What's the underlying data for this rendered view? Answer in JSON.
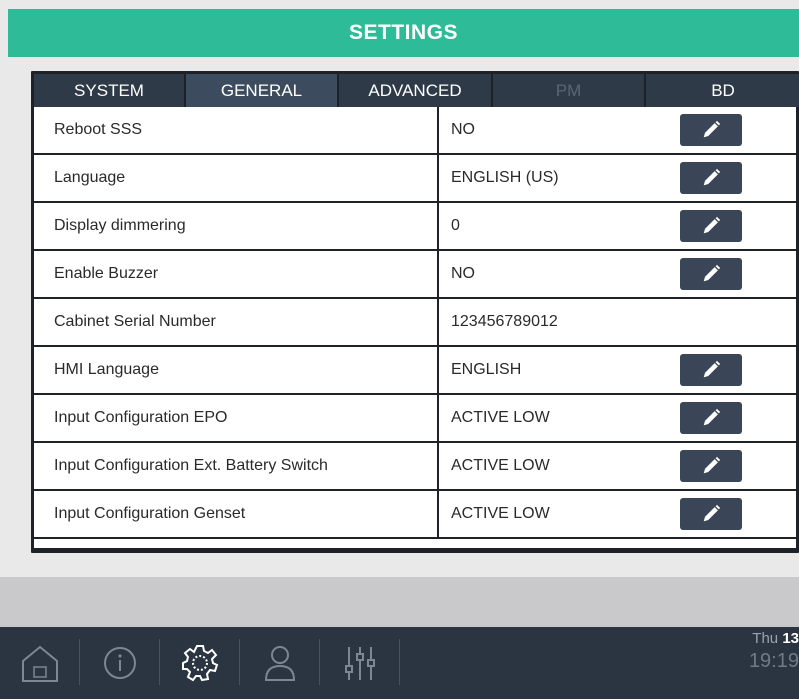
{
  "header": {
    "title": "SETTINGS"
  },
  "tabs": [
    {
      "label": "SYSTEM"
    },
    {
      "label": "GENERAL"
    },
    {
      "label": "ADVANCED"
    },
    {
      "label": "PM"
    },
    {
      "label": "BD"
    }
  ],
  "active_tab": "GENERAL",
  "rows": [
    {
      "label": "Reboot SSS",
      "value": "NO",
      "editable": true
    },
    {
      "label": "Language",
      "value": "ENGLISH (US)",
      "editable": true
    },
    {
      "label": "Display dimmering",
      "value": "0",
      "editable": true
    },
    {
      "label": "Enable Buzzer",
      "value": "NO",
      "editable": true
    },
    {
      "label": "Cabinet Serial Number",
      "value": "123456789012",
      "editable": false
    },
    {
      "label": "HMI Language",
      "value": "ENGLISH",
      "editable": true
    },
    {
      "label": "Input Configuration EPO",
      "value": "ACTIVE LOW",
      "editable": true
    },
    {
      "label": "Input Configuration Ext. Battery Switch",
      "value": "ACTIVE LOW",
      "editable": true
    },
    {
      "label": "Input Configuration Genset",
      "value": "ACTIVE LOW",
      "editable": true
    }
  ],
  "nav": [
    {
      "icon": "home-icon"
    },
    {
      "icon": "info-icon"
    },
    {
      "icon": "gear-icon"
    },
    {
      "icon": "user-icon"
    },
    {
      "icon": "sliders-icon"
    }
  ],
  "clock": {
    "day": "Thu",
    "date": "13",
    "time": "19:19"
  },
  "colors": {
    "accent": "#2dbb98",
    "panel": "#1e2228",
    "edit_button": "#3a4657",
    "bottombar": "#2b3541"
  }
}
